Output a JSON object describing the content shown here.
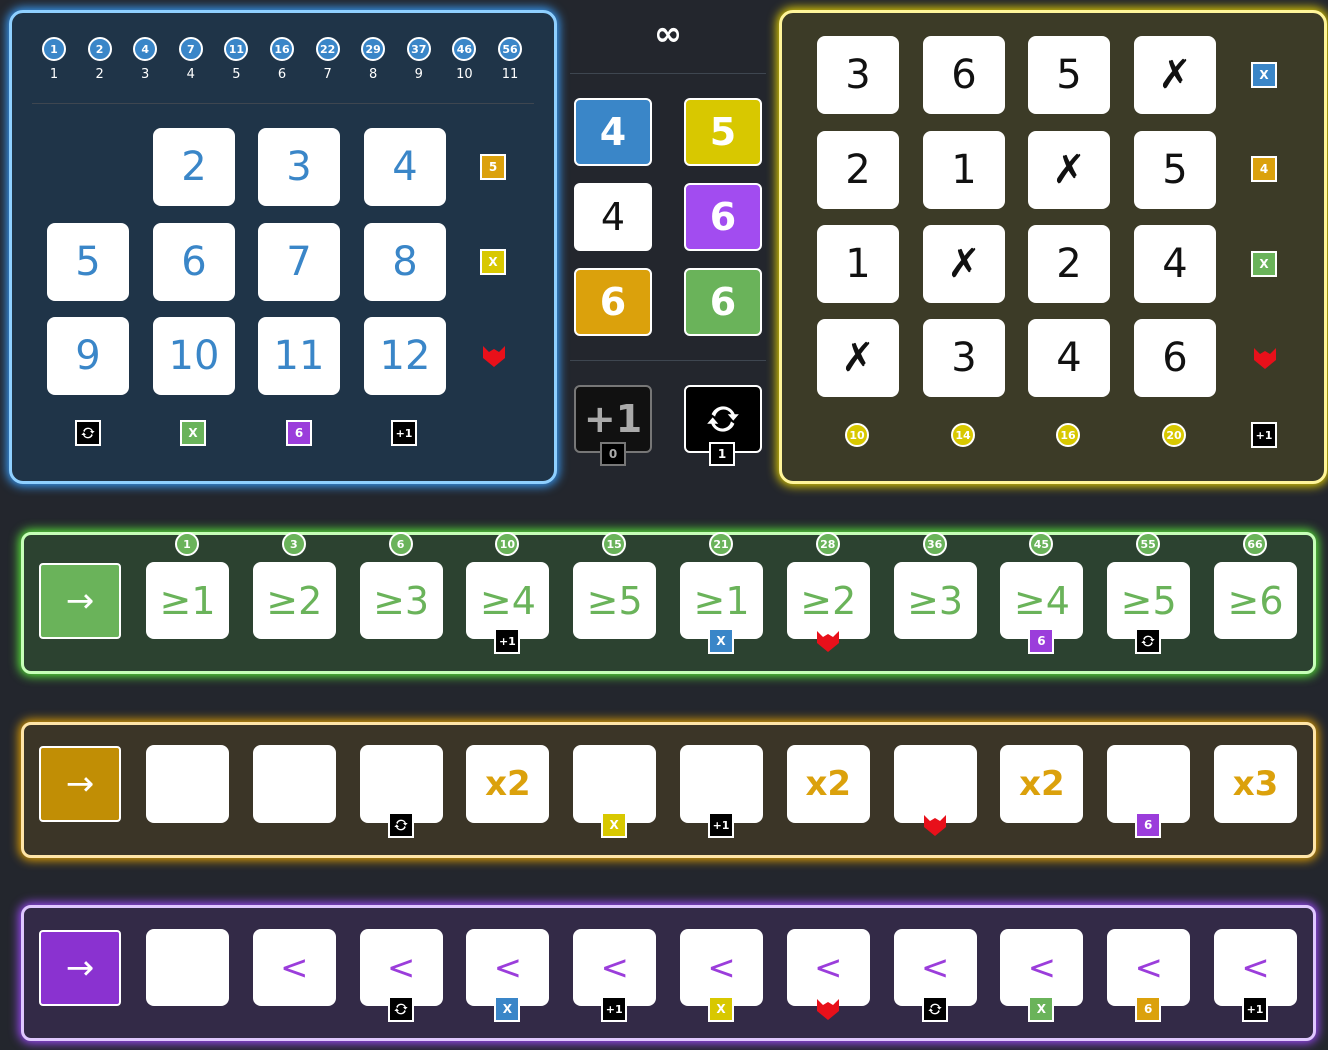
{
  "blue": {
    "top_row": [
      {
        "circle": "1",
        "label": "1"
      },
      {
        "circle": "2",
        "label": "2"
      },
      {
        "circle": "4",
        "label": "3"
      },
      {
        "circle": "7",
        "label": "4"
      },
      {
        "circle": "11",
        "label": "5"
      },
      {
        "circle": "16",
        "label": "6"
      },
      {
        "circle": "22",
        "label": "7"
      },
      {
        "circle": "29",
        "label": "8"
      },
      {
        "circle": "37",
        "label": "9"
      },
      {
        "circle": "46",
        "label": "10"
      },
      {
        "circle": "56",
        "label": "11"
      }
    ],
    "grid": [
      [
        "",
        "2",
        "3",
        "4"
      ],
      [
        "5",
        "6",
        "7",
        "8"
      ],
      [
        "9",
        "10",
        "11",
        "12"
      ]
    ],
    "row_bonus": [
      "5",
      "X",
      "fox-icon"
    ],
    "col_bonus": [
      "reroll-icon",
      "X",
      "6",
      "+1"
    ]
  },
  "center": {
    "infinity": "∞",
    "dice": [
      {
        "value": "4",
        "color": "#3a86c8",
        "text": "#ffffff"
      },
      {
        "value": "5",
        "color": "#d8c800",
        "text": "#ffffff"
      },
      {
        "value": "4",
        "color": "#ffffff",
        "text": "#111111"
      },
      {
        "value": "6",
        "color": "#a24cf0",
        "text": "#ffffff"
      },
      {
        "value": "6",
        "color": "#dba10c",
        "text": "#ffffff"
      },
      {
        "value": "6",
        "color": "#6ab35a",
        "text": "#ffffff"
      }
    ],
    "plus_one": {
      "label": "+1",
      "count": "0"
    },
    "reroll": {
      "count": "1"
    }
  },
  "yellow": {
    "grid": [
      [
        "3",
        "6",
        "5",
        "✗"
      ],
      [
        "2",
        "1",
        "✗",
        "5"
      ],
      [
        "1",
        "✗",
        "2",
        "4"
      ],
      [
        "✗",
        "3",
        "4",
        "6"
      ]
    ],
    "row_bonus": [
      "X",
      "4",
      "X",
      "fox-icon"
    ],
    "col_points": [
      "10",
      "14",
      "16",
      "20"
    ],
    "corner_bonus": "+1"
  },
  "green": {
    "thresholds": [
      "≥1",
      "≥2",
      "≥3",
      "≥4",
      "≥5",
      "≥1",
      "≥2",
      "≥3",
      "≥4",
      "≥5",
      "≥6"
    ],
    "points": [
      "1",
      "3",
      "6",
      "10",
      "15",
      "21",
      "28",
      "36",
      "45",
      "55",
      "66"
    ],
    "bonuses": [
      "",
      "",
      "",
      "+1",
      "",
      "X",
      "fox",
      "",
      "6",
      "reroll",
      ""
    ]
  },
  "orange": {
    "cells": [
      "",
      "",
      "",
      "x2",
      "",
      "",
      "x2",
      "",
      "x2",
      "",
      "x3"
    ],
    "bonuses": [
      "",
      "",
      "reroll",
      "",
      "X",
      "+1",
      "",
      "fox",
      "",
      "6",
      ""
    ]
  },
  "purple": {
    "cells": [
      "",
      "<",
      "<",
      "<",
      "<",
      "<",
      "<",
      "<",
      "<",
      "<",
      "<"
    ],
    "bonuses": [
      "",
      "",
      "reroll",
      "X",
      "+1",
      "X",
      "fox",
      "reroll",
      "X",
      "6",
      "+1"
    ]
  },
  "arrow": "→"
}
